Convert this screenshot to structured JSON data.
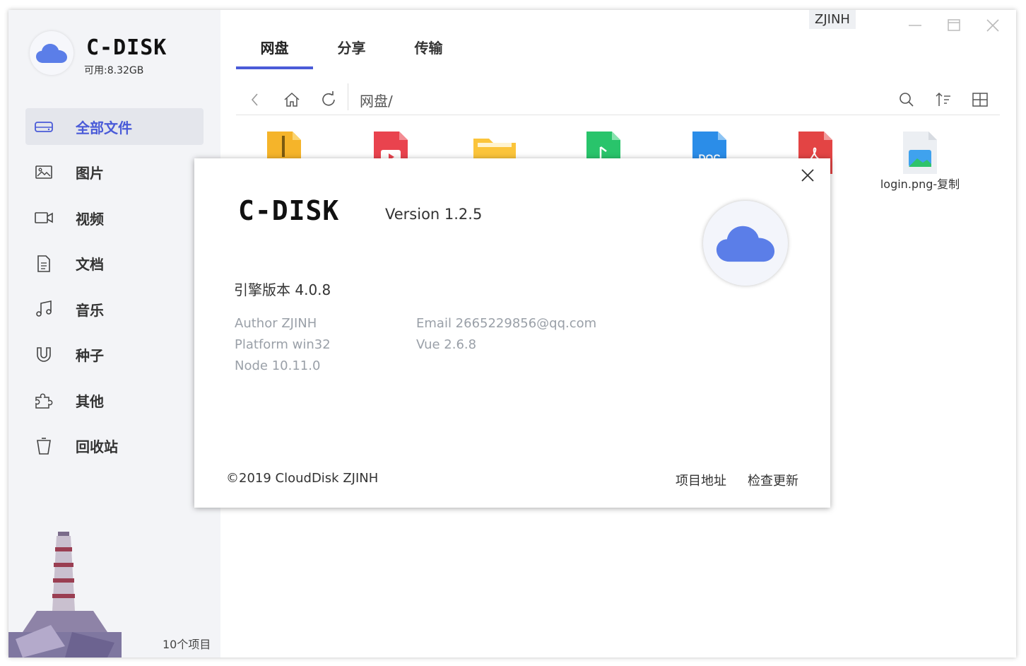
{
  "sidebar": {
    "brand": "C-DISK",
    "available": "可用:8.32GB",
    "items": [
      {
        "label": "全部文件",
        "icon": "hard-drive-icon"
      },
      {
        "label": "图片",
        "icon": "image-icon"
      },
      {
        "label": "视频",
        "icon": "video-camera-icon"
      },
      {
        "label": "文档",
        "icon": "document-icon"
      },
      {
        "label": "音乐",
        "icon": "music-note-icon"
      },
      {
        "label": "种子",
        "icon": "magnet-icon"
      },
      {
        "label": "其他",
        "icon": "puzzle-icon"
      },
      {
        "label": "回收站",
        "icon": "trash-icon"
      }
    ],
    "item_count": "10个项目"
  },
  "header": {
    "tabs": [
      "网盘",
      "分享",
      "传输"
    ],
    "user": "ZJINH"
  },
  "toolbar": {
    "path": "网盘/"
  },
  "files": [
    {
      "icon": "zip-file-icon"
    },
    {
      "icon": "video-file-icon"
    },
    {
      "icon": "folder-icon"
    },
    {
      "icon": "audio-file-icon"
    },
    {
      "icon": "doc-file-icon",
      "badge": "DOC"
    },
    {
      "icon": "pdf-file-icon"
    },
    {
      "icon": "image-file-icon",
      "name": "login.png-复制"
    }
  ],
  "dialog": {
    "brand": "C-DISK",
    "version": "Version  1.2.5",
    "engine": "引擎版本  4.0.8",
    "author": "Author  ZJINH",
    "platform": "Platform  win32",
    "node": "Node  10.11.0",
    "email": "Email  2665229856@qq.com",
    "vue": "Vue  2.6.8",
    "copyright": "©2019 CloudDisk ZJINH",
    "project_link": "项目地址",
    "update_link": "检查更新"
  },
  "colors": {
    "accent": "#4a5bd8",
    "cloud": "#5b7ee8",
    "sidebar_bg": "#f3f4f7"
  }
}
